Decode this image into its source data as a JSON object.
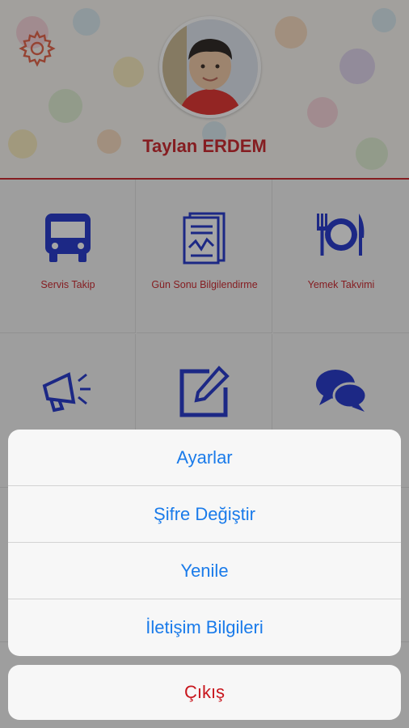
{
  "profile": {
    "name": "Taylan ERDEM"
  },
  "menu": [
    {
      "label": "Servis Takip",
      "icon": "bus-icon"
    },
    {
      "label": "Gün Sonu Bilgilendirme",
      "icon": "report-icon"
    },
    {
      "label": "Yemek Takvimi",
      "icon": "meal-icon"
    },
    {
      "label": "",
      "icon": "megaphone-icon"
    },
    {
      "label": "",
      "icon": "edit-icon"
    },
    {
      "label": "",
      "icon": "chat-icon"
    }
  ],
  "action_sheet": {
    "items": [
      "Ayarlar",
      "Şifre Değiştir",
      "Yenile",
      "İletişim Bilgileri"
    ],
    "cancel": "Çıkış"
  },
  "colors": {
    "accent_red": "#c8161d",
    "icon_blue": "#1428c8",
    "ios_blue": "#1a7bea"
  }
}
